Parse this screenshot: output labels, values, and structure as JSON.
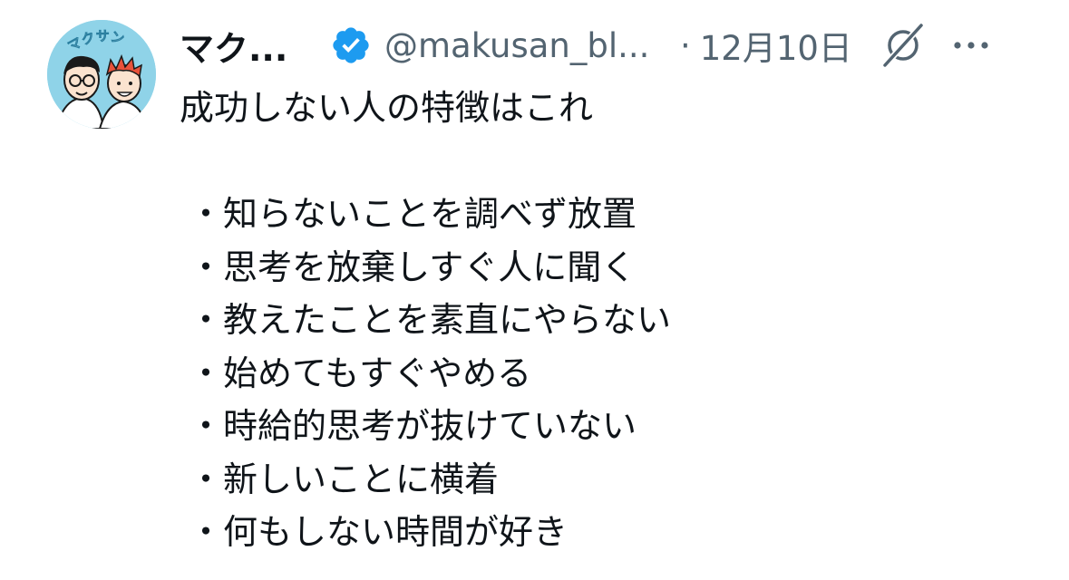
{
  "user": {
    "display_name": "マク...",
    "handle": "@makusan_bl...",
    "separator": "·",
    "date": "12月10日",
    "avatar_text": "マクサン",
    "avatar_icon": "cartoon-avatar",
    "verified_icon": "verified-badge-icon",
    "verified_color": "#1d9bf0"
  },
  "actions": {
    "grok_icon": "grok-icon",
    "more_icon": "more-options-icon"
  },
  "tweet": {
    "title": "成功しない人の特徴はこれ",
    "bullets": [
      "・知らないことを調べず放置",
      "・思考を放棄しすぐ人に聞く",
      "・教えたことを素直にやらない",
      "・始めてもすぐやめる",
      "・時給的思考が抜けていない",
      "・新しいことに横着",
      "・何もしない時間が好き"
    ]
  },
  "colors": {
    "text": "#0f1419",
    "secondary_text": "#536471",
    "avatar_bg": "#8fd3e8"
  }
}
